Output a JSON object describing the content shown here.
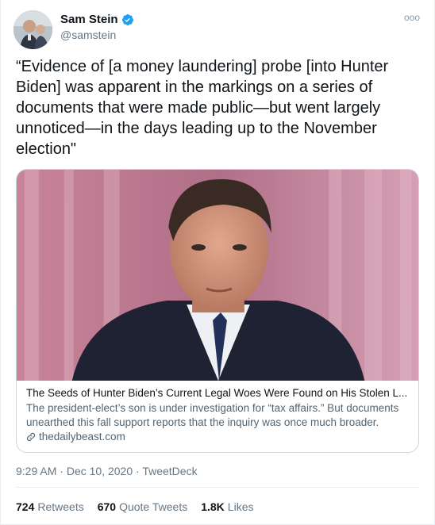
{
  "author": {
    "display_name": "Sam Stein",
    "handle": "@samstein",
    "verified": true
  },
  "more_menu_glyph": "ooo",
  "tweet_text": "“Evidence of [a money laundering] probe [into Hunter Biden] was apparent in the markings on a series of documents that were made public—but went largely unnoticed—in the days leading up to the November election\"",
  "card": {
    "title": "The Seeds of Hunter Biden’s Current Legal Woes Were Found on His Stolen L...",
    "description": "The president-elect’s son is under investigation for “tax affairs.” But documents unearthed this fall support reports that the inquiry was once much broader.",
    "domain": "thedailybeast.com"
  },
  "meta": {
    "time": "9:29 AM",
    "separator": "·",
    "date": "Dec 10, 2020",
    "source": "TweetDeck"
  },
  "stats": {
    "retweets_count": "724",
    "retweets_label": "Retweets",
    "quotes_count": "670",
    "quotes_label": "Quote Tweets",
    "likes_count": "1.8K",
    "likes_label": "Likes"
  },
  "colors": {
    "verified_blue": "#1da1f2",
    "secondary_text": "#657786",
    "border": "#ccd6dd"
  }
}
